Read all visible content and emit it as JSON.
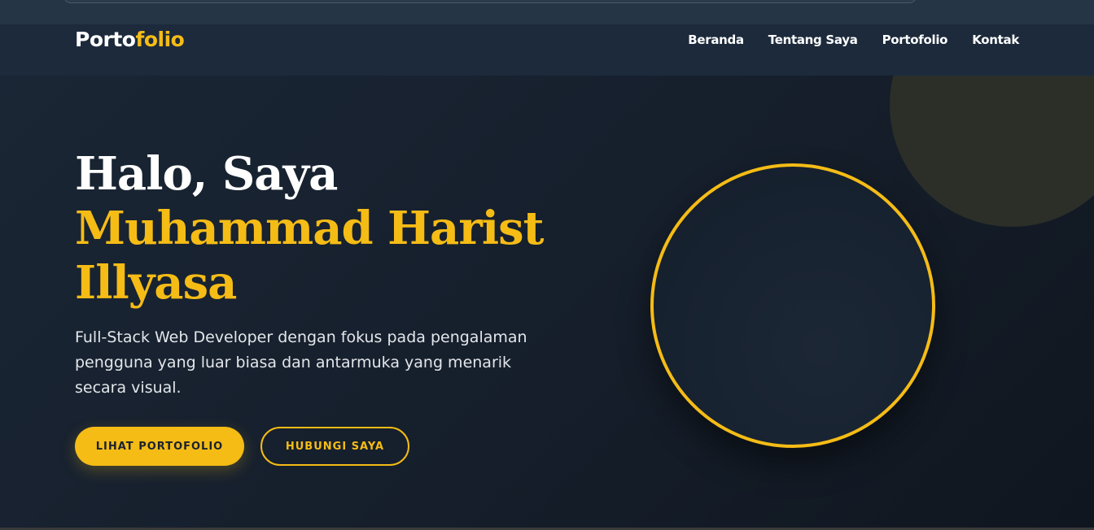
{
  "navbar": {
    "logo_main": "Porto",
    "logo_accent": "folio",
    "links": [
      "Beranda",
      "Tentang Saya",
      "Portofolio",
      "Kontak"
    ]
  },
  "hero": {
    "greeting": "Halo, Saya",
    "name_line1": "Muhammad Harist",
    "name_line2": "Illyasa",
    "description": "Full-Stack Web Developer dengan fokus pada pengalaman pengguna yang luar biasa dan antarmuka yang menarik secara visual.",
    "primary_button": "LIHAT PORTOFOLIO",
    "secondary_button": "HUBUNGI SAYA"
  },
  "colors": {
    "accent": "#f5bc16",
    "navbar_bg": "#1c2a3b",
    "hero_bg": "#161f2c",
    "text": "#ffffff"
  }
}
